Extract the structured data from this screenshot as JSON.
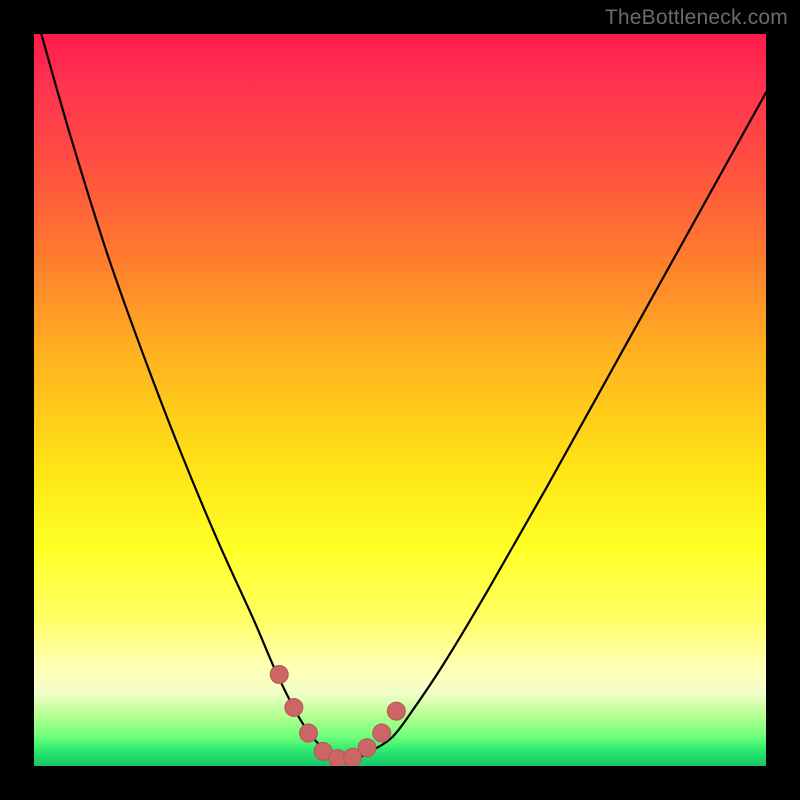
{
  "watermark": "TheBottleneck.com",
  "colors": {
    "page_bg": "#000000",
    "curve_stroke": "#000000",
    "marker_fill": "#cc6666",
    "marker_stroke": "#b85555"
  },
  "chart_data": {
    "type": "line",
    "title": "",
    "xlabel": "",
    "ylabel": "",
    "xlim": [
      0,
      100
    ],
    "ylim": [
      0,
      100
    ],
    "series": [
      {
        "name": "bottleneck-curve",
        "x": [
          1,
          5,
          10,
          15,
          20,
          25,
          30,
          33,
          36,
          38,
          40,
          42,
          44,
          46,
          49,
          52,
          56,
          62,
          70,
          80,
          90,
          100
        ],
        "values": [
          100,
          86,
          70,
          56,
          43,
          31,
          20,
          13,
          7,
          4,
          2,
          1,
          1,
          2,
          4,
          8,
          14,
          24,
          38,
          56,
          74,
          92
        ]
      }
    ],
    "markers": {
      "name": "highlighted-range",
      "x": [
        33.5,
        35.5,
        37.5,
        39.5,
        41.5,
        43.5,
        45.5,
        47.5,
        49.5
      ],
      "values": [
        12.5,
        8.0,
        4.5,
        2.0,
        1.0,
        1.2,
        2.5,
        4.5,
        7.5
      ]
    }
  }
}
